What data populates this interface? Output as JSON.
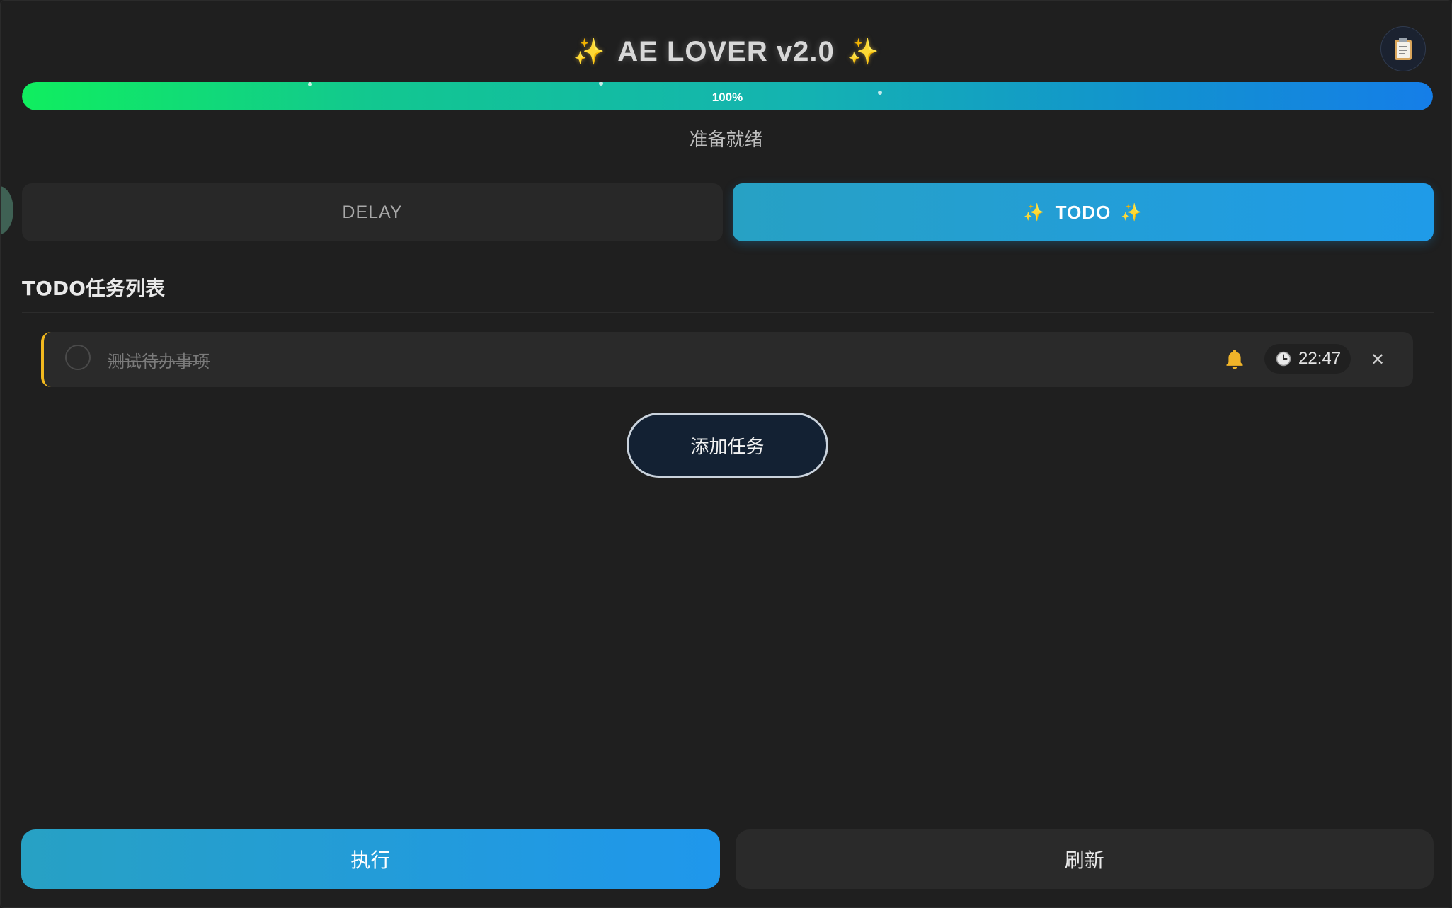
{
  "header": {
    "title": "AE LOVER v2.0",
    "sparkle_left": "✨",
    "sparkle_right": "✨",
    "clipboard_icon": "📋"
  },
  "progress": {
    "value_percent": 100,
    "label": "100%",
    "status_text": "准备就绪"
  },
  "tabs": [
    {
      "label": "DELAY",
      "active": false
    },
    {
      "label": "TODO",
      "active": true,
      "sparkle": "✨"
    }
  ],
  "todo": {
    "section_title": "TODO任务列表",
    "items": [
      {
        "text": "测试待办事项",
        "completed": true,
        "reminder_icon": "bell-icon",
        "time": "22:47",
        "delete_glyph": "✕"
      }
    ],
    "add_button_label": "添加任务"
  },
  "footer": {
    "run_label": "执行",
    "refresh_label": "刷新"
  },
  "colors": {
    "background": "#1f1f1f",
    "accent_blue": "#1f9be8",
    "progress_start": "#10ee5f",
    "progress_end": "#157ee8",
    "todo_border": "#f2b91f",
    "sparkle": "#f7c948"
  }
}
